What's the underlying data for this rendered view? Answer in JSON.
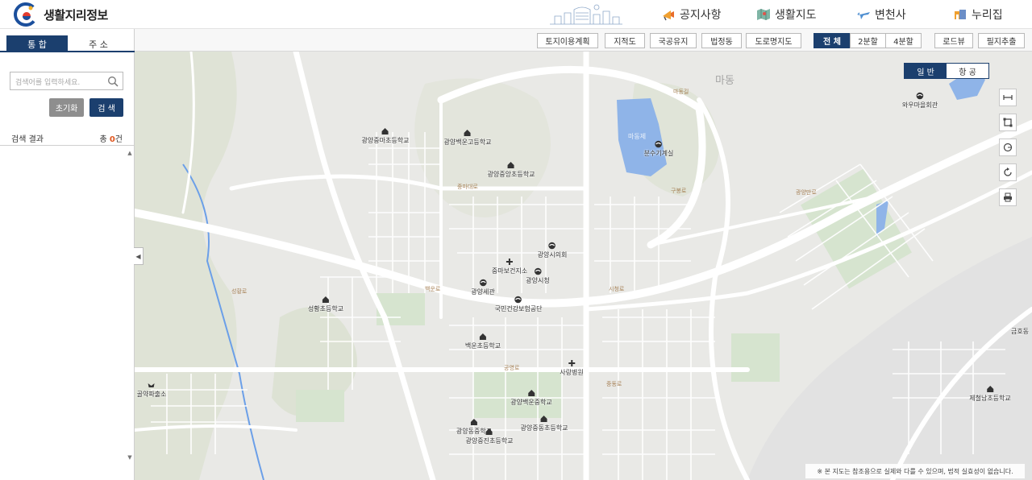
{
  "header": {
    "logo_text": "생활지리정보",
    "nav": [
      {
        "label": "공지사항",
        "icon": "notice-megaphone-icon"
      },
      {
        "label": "생활지도",
        "icon": "map-icon"
      },
      {
        "label": "변천사",
        "icon": "airplane-icon"
      },
      {
        "label": "누리집",
        "icon": "home-box-icon"
      }
    ]
  },
  "toolbar": {
    "layers": [
      "토지이용계획",
      "지적도",
      "국공유지",
      "법정동",
      "도로명지도"
    ],
    "split": [
      "전 체",
      "2분할",
      "4분할"
    ],
    "extra": [
      "로드뷰",
      "필지추출"
    ]
  },
  "left_panel": {
    "tabs": [
      "통 합",
      "주 소"
    ],
    "search_placeholder": "검색어를 입력하세요.",
    "reset_label": "초기화",
    "search_label": "검 색",
    "result_label": "검색 결과",
    "result_prefix": "총 ",
    "result_count": "0",
    "result_suffix": "건"
  },
  "map": {
    "map_types": [
      "일 반",
      "항 공"
    ],
    "notice": "※ 본 지도는 참조용으로 실제와 다를 수 있으며, 법적 실효성이 없습니다.",
    "area_label": "마동",
    "lake_label": "마동제",
    "pois": [
      {
        "name": "광양중마초등학교",
        "type": "school"
      },
      {
        "name": "광양백운고등학교",
        "type": "school"
      },
      {
        "name": "광양중앙초등학교",
        "type": "school"
      },
      {
        "name": "분수기계실",
        "type": "gov"
      },
      {
        "name": "와우마을회관",
        "type": "gov"
      },
      {
        "name": "광양시의회",
        "type": "gov"
      },
      {
        "name": "중마보건지소",
        "type": "hospital"
      },
      {
        "name": "광양시청",
        "type": "gov"
      },
      {
        "name": "광양세관",
        "type": "gov"
      },
      {
        "name": "국민건강보험공단",
        "type": "gov"
      },
      {
        "name": "성황초등학교",
        "type": "school"
      },
      {
        "name": "백운초등학교",
        "type": "school"
      },
      {
        "name": "사랑병원",
        "type": "hospital"
      },
      {
        "name": "골약파출소",
        "type": "police"
      },
      {
        "name": "광양백운중학교",
        "type": "school"
      },
      {
        "name": "광양동중학교",
        "type": "school"
      },
      {
        "name": "광양중동초등학교",
        "type": "school"
      },
      {
        "name": "광양중진초등학교",
        "type": "school"
      },
      {
        "name": "제철남초등학교",
        "type": "school"
      },
      {
        "name": "금호동",
        "type": "area"
      }
    ],
    "roads": [
      "중마대로",
      "백운로",
      "시청로",
      "공영로",
      "구봉로",
      "마동길",
      "중동로",
      "성황로",
      "광양만로"
    ]
  }
}
